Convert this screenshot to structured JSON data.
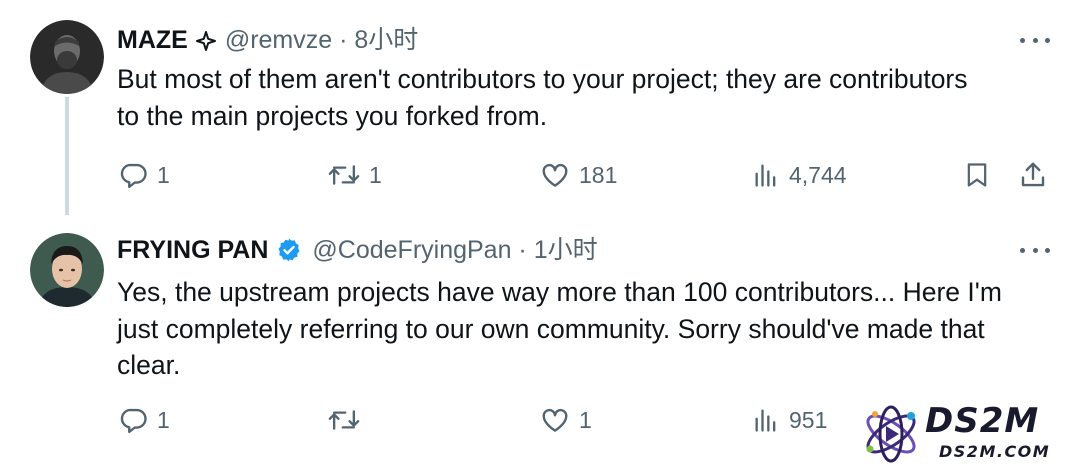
{
  "tweets": [
    {
      "display_name": "MAZE",
      "badge": "sparkle-icon",
      "meta": "@remvze · 8小时",
      "text_lines": [
        "But most of them aren't contributors to your project; they are contributors",
        "to the main projects you forked from."
      ],
      "actions": {
        "replies": "1",
        "reposts": "1",
        "likes": "181",
        "views": "4,744"
      }
    },
    {
      "display_name": "FRYING PAN",
      "badge": "verified-badge-icon",
      "meta": "@CodeFryingPan · 1小时",
      "text_lines": [
        "Yes, the upstream projects have way more than 100 contributors... Here I'm",
        "just completely referring to our own community. Sorry should've made that",
        "clear."
      ],
      "actions": {
        "replies": "1",
        "reposts": "",
        "likes": "1",
        "views": "951"
      }
    }
  ],
  "watermark": {
    "big": "DS2M",
    "small": "DS2M.COM"
  },
  "colors": {
    "text": "#0f1419",
    "secondary": "#536471",
    "verified": "#1d9bf0",
    "thread_line": "#cfd9de"
  }
}
